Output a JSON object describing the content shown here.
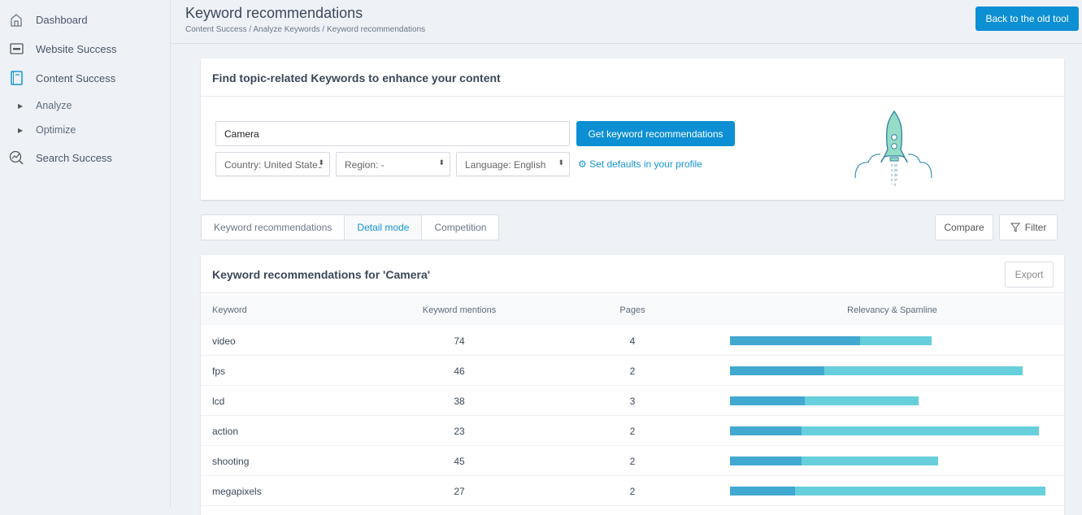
{
  "sidebar": {
    "items": [
      {
        "label": "Dashboard",
        "icon": "home-icon"
      },
      {
        "label": "Website Success",
        "icon": "monitor-icon"
      },
      {
        "label": "Content Success",
        "icon": "book-icon",
        "active": true
      },
      {
        "label": "Analyze",
        "icon": "caret-right-icon"
      },
      {
        "label": "Optimize",
        "icon": "caret-right-icon"
      },
      {
        "label": "Search Success",
        "icon": "search-chart-icon"
      }
    ]
  },
  "header": {
    "title": "Keyword recommendations",
    "breadcrumb": "Content Success / Analyze Keywords / Keyword recommendations",
    "back_button": "Back to the old tool"
  },
  "finder": {
    "heading": "Find topic-related Keywords to enhance your content",
    "query": "Camera",
    "submit": "Get keyword recommendations",
    "country": "Country: United States",
    "region": "Region: -",
    "language": "Language: English",
    "defaults_link": "Set defaults in your profile"
  },
  "tabs": [
    {
      "label": "Keyword recommendations"
    },
    {
      "label": "Detail mode",
      "active": true
    },
    {
      "label": "Competition"
    }
  ],
  "actions": {
    "compare": "Compare",
    "filter": "Filter"
  },
  "results": {
    "heading": "Keyword recommendations for 'Camera'",
    "export": "Export",
    "columns": [
      "Keyword",
      "Keyword mentions",
      "Pages",
      "Relevancy & Spamline"
    ],
    "colors": {
      "relevancy": "#41a9d0",
      "spamline": "#67cfdb"
    },
    "rows": [
      {
        "keyword": "video",
        "mentions": "74",
        "pages": "4",
        "relevancy": 40,
        "spamline": 62
      },
      {
        "keyword": "fps",
        "mentions": "46",
        "pages": "2",
        "relevancy": 29,
        "spamline": 90
      },
      {
        "keyword": "lcd",
        "mentions": "38",
        "pages": "3",
        "relevancy": 23,
        "spamline": 58
      },
      {
        "keyword": "action",
        "mentions": "23",
        "pages": "2",
        "relevancy": 22,
        "spamline": 95
      },
      {
        "keyword": "shooting",
        "mentions": "45",
        "pages": "2",
        "relevancy": 22,
        "spamline": 64
      },
      {
        "keyword": "megapixels",
        "mentions": "27",
        "pages": "2",
        "relevancy": 20,
        "spamline": 97
      }
    ]
  }
}
